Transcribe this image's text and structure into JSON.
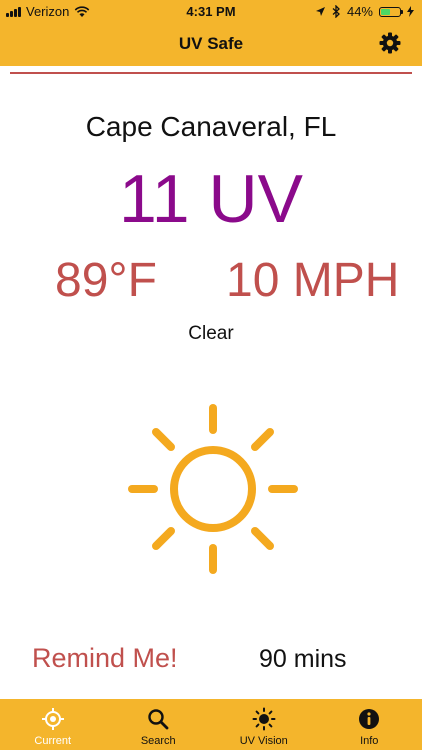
{
  "status": {
    "carrier": "Verizon",
    "time": "4:31 PM",
    "battery": "44%",
    "battery_level": 0.44
  },
  "header": {
    "title": "UV Safe"
  },
  "weather": {
    "location": "Cape Canaveral, FL",
    "uv": "11 UV",
    "temperature": "89°F",
    "wind": "10 MPH",
    "condition": "Clear"
  },
  "reminder": {
    "button_label": "Remind Me!",
    "duration": "90 mins"
  },
  "tabs": [
    {
      "label": "Current",
      "icon": "location-target-icon",
      "active": true
    },
    {
      "label": "Search",
      "icon": "search-icon",
      "active": false
    },
    {
      "label": "UV Vision",
      "icon": "sun-icon",
      "active": false
    },
    {
      "label": "Info",
      "icon": "info-icon",
      "active": false
    }
  ],
  "colors": {
    "brand_yellow": "#F4B52C",
    "uv_purple": "#8B0A8B",
    "accent_red": "#C0504D",
    "sun_orange": "#F4A91F"
  }
}
